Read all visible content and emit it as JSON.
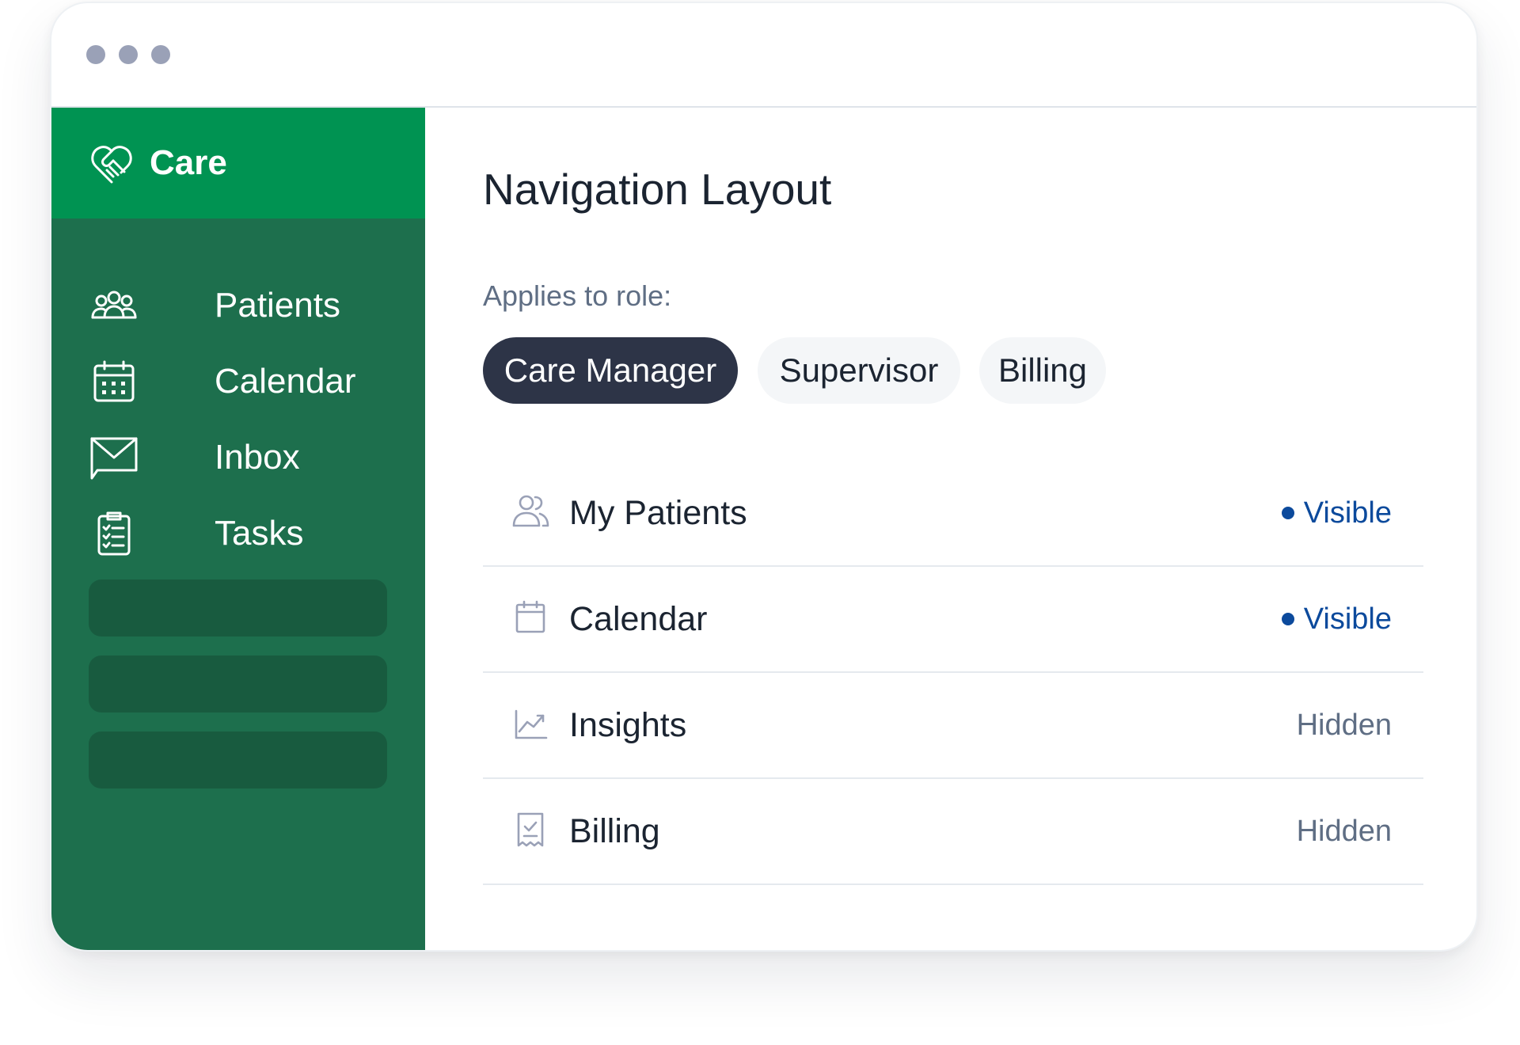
{
  "colors": {
    "sidebar_brand": "#009352",
    "sidebar_bg": "#1d6f4d",
    "sidebar_placeholder": "#185b3f",
    "active_chip": "#2d3447",
    "visible_status": "#0c4a9c",
    "hidden_status": "#5f6e84",
    "window_dot": "#9aa1b7"
  },
  "window": {
    "dots": [
      "window-dot",
      "window-dot",
      "window-dot"
    ]
  },
  "sidebar": {
    "brand": {
      "label": "Care",
      "icon": "heart-handshake-icon"
    },
    "items": [
      {
        "label": "Patients",
        "icon": "users-icon"
      },
      {
        "label": "Calendar",
        "icon": "calendar-grid-icon"
      },
      {
        "label": "Inbox",
        "icon": "mail-icon"
      },
      {
        "label": "Tasks",
        "icon": "clipboard-list-icon"
      }
    ]
  },
  "main": {
    "title": "Navigation Layout",
    "role_label": "Applies to role:",
    "roles": [
      {
        "label": "Care Manager",
        "active": true
      },
      {
        "label": "Supervisor",
        "active": false
      },
      {
        "label": "Billing",
        "active": false
      }
    ],
    "nav_rows": [
      {
        "label": "My Patients",
        "icon": "users-outline-icon",
        "status": "Visible",
        "visible": true
      },
      {
        "label": "Calendar",
        "icon": "calendar-outline-icon",
        "status": "Visible",
        "visible": true
      },
      {
        "label": "Insights",
        "icon": "trend-chart-icon",
        "status": "Hidden",
        "visible": false
      },
      {
        "label": "Billing",
        "icon": "receipt-icon",
        "status": "Hidden",
        "visible": false
      }
    ]
  }
}
